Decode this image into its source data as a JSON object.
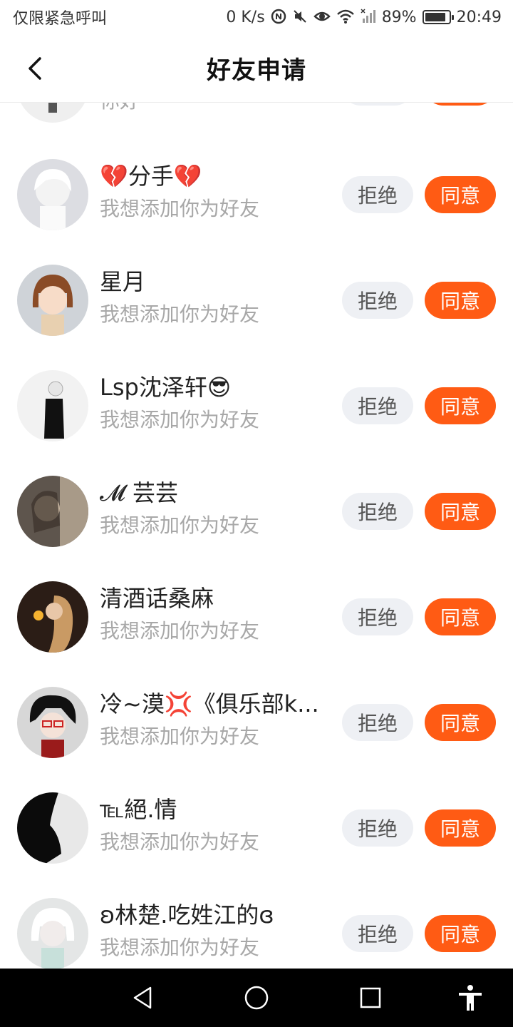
{
  "status_bar": {
    "carrier": "仅限紧急呼叫",
    "net_speed": "0 K/s",
    "battery": "89%",
    "battery_level": 0.89,
    "time": "20:49",
    "icons": [
      "nfc-icon",
      "mute-icon",
      "eye-icon",
      "wifi-icon",
      "signal-icon",
      "battery-icon"
    ]
  },
  "header": {
    "title": "好友申请",
    "back_icon": "chevron-left-icon"
  },
  "buttons": {
    "reject": "拒绝",
    "accept": "同意"
  },
  "requests": [
    {
      "name": "",
      "message": "你好"
    },
    {
      "name": "💔分手💔",
      "message": "我想添加你为好友"
    },
    {
      "name": "星月",
      "message": "我想添加你为好友"
    },
    {
      "name": "Lsp沈泽轩😎",
      "message": "我想添加你为好友"
    },
    {
      "name": "𝓜 芸芸",
      "message": "我想添加你为好友"
    },
    {
      "name": "清酒话桑麻",
      "message": "我想添加你为好友"
    },
    {
      "name": "冷~漠💢《俱乐部k...",
      "message": "我想添加你为好友"
    },
    {
      "name": "℡絕.情",
      "message": "我想添加你为好友"
    },
    {
      "name": "ʚ林楚.吃姓江的ɞ",
      "message": "我想添加你为好友"
    }
  ],
  "nav_bar": {
    "icons": [
      "back-triangle-icon",
      "home-circle-icon",
      "recents-square-icon",
      "accessibility-icon"
    ]
  },
  "colors": {
    "accent": "#ff5b14",
    "reject_bg": "#eef0f4",
    "secondary_text": "#a8a8a8"
  }
}
